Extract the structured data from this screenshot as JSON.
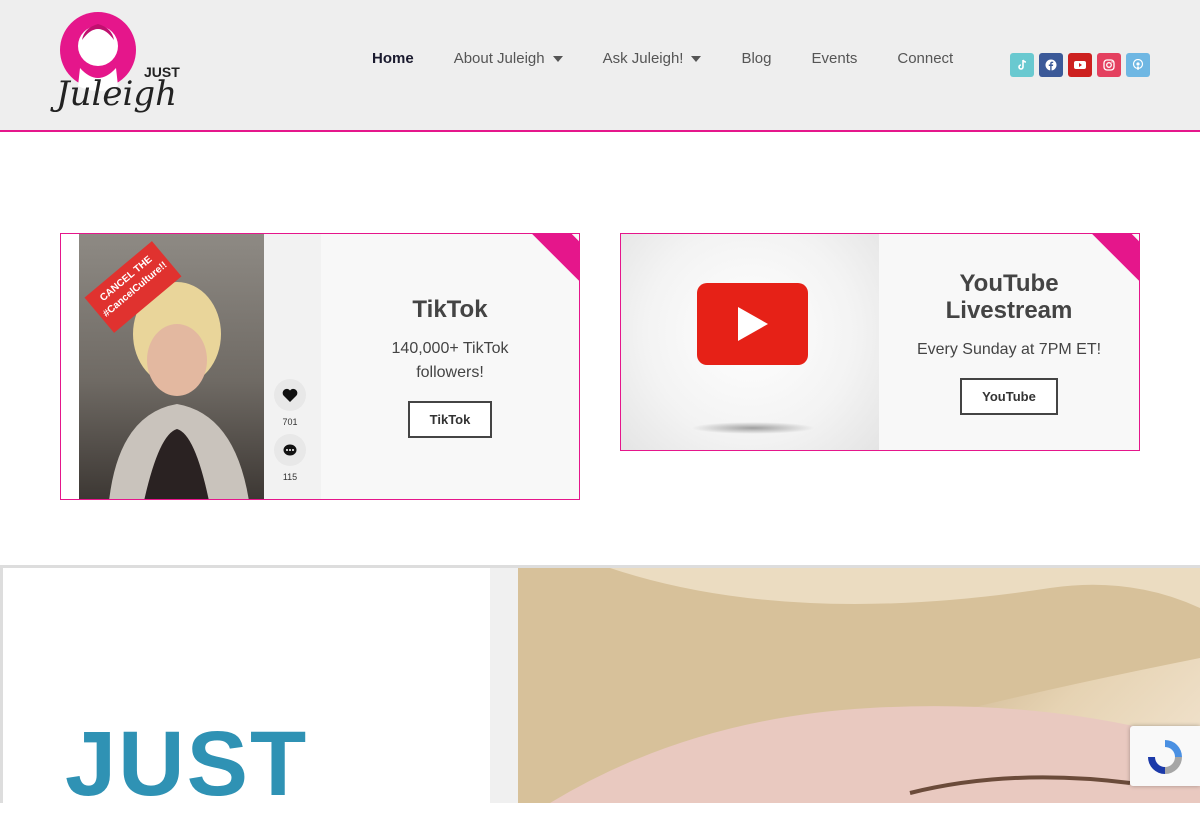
{
  "header": {
    "logo": {
      "text_top": "JUST",
      "text_script": "Juleigh"
    },
    "nav": [
      {
        "label": "Home",
        "active": true,
        "dropdown": false
      },
      {
        "label": "About Juleigh",
        "active": false,
        "dropdown": true
      },
      {
        "label": "Ask Juleigh!",
        "active": false,
        "dropdown": true
      },
      {
        "label": "Blog",
        "active": false,
        "dropdown": false
      },
      {
        "label": "Events",
        "active": false,
        "dropdown": false
      },
      {
        "label": "Connect",
        "active": false,
        "dropdown": false
      }
    ],
    "social": [
      {
        "icon": "tiktok-icon",
        "color": "#69c9d0"
      },
      {
        "icon": "facebook-icon",
        "color": "#3b5998"
      },
      {
        "icon": "youtube-icon",
        "color": "#cd201f"
      },
      {
        "icon": "instagram-icon",
        "color": "#e4405f"
      },
      {
        "icon": "podcast-icon",
        "color": "#6fb7e3"
      }
    ]
  },
  "cards": {
    "tiktok": {
      "title": "TikTok",
      "text": "140,000+ TikTok followers!",
      "button": "TikTok",
      "video": {
        "sticker_line1": "CANCEL THE",
        "sticker_line2": "#CancelCulture!!",
        "likes": "701",
        "comments": "115"
      }
    },
    "youtube": {
      "title_line1": "YouTube",
      "title_line2": "Livestream",
      "text": "Every Sunday at 7PM ET!",
      "button": "YouTube"
    }
  },
  "hero": {
    "title": "JUST"
  },
  "colors": {
    "accent": "#e5168b",
    "hero_title": "#2f92b4",
    "header_bg": "#eeeeee"
  }
}
